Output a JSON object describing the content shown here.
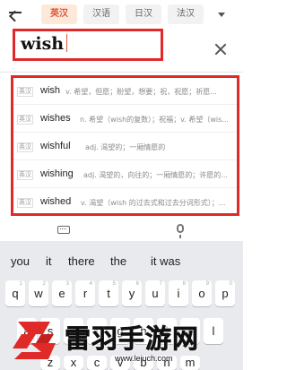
{
  "lang_tabs": [
    "英汉",
    "汉语",
    "日汉",
    "法汉"
  ],
  "search": {
    "value": "wish"
  },
  "suggestions": [
    {
      "tag": "英汉",
      "word": "wish",
      "definition": "v. 希望，但愿；盼望，想要；祝，祝愿；祈愿..."
    },
    {
      "tag": "英汉",
      "word": "wishes",
      "definition": "n. 希望（wish的复数）；祝福；v. 希望（wis..."
    },
    {
      "tag": "英汉",
      "word": "wishful",
      "definition": "adj. 渴望的；一厢情愿的"
    },
    {
      "tag": "英汉",
      "word": "wishing",
      "definition": "adj. 渴望的，向往的；一厢情愿的；许愿的..."
    },
    {
      "tag": "英汉",
      "word": "wished",
      "definition": "v. 渴望（wish 的过去式和过去分词形式）；..."
    }
  ],
  "keyboard": {
    "candidates": [
      "you",
      "it",
      "there",
      "the",
      "it was"
    ],
    "row1": [
      "q",
      "w",
      "e",
      "r",
      "t",
      "y",
      "u",
      "i",
      "o",
      "p"
    ],
    "row1_hints": [
      "1",
      "2",
      "3",
      "4",
      "5",
      "6",
      "7",
      "8",
      "9",
      "0"
    ],
    "row2": [
      "a",
      "s",
      "d",
      "f",
      "g",
      "h",
      "j",
      "k",
      "l"
    ],
    "row3": [
      "z",
      "x",
      "c",
      "v",
      "b",
      "n",
      "m"
    ]
  },
  "watermark": {
    "title": "雷羽手游网",
    "url": "www.leiuch.com",
    "accent_color": "#e02a2a"
  },
  "colors": {
    "highlight": "#e02a2a",
    "active_tab_bg": "#fde9d9",
    "active_tab_text": "#e0553a",
    "keyboard_bg": "#e9eaee"
  }
}
